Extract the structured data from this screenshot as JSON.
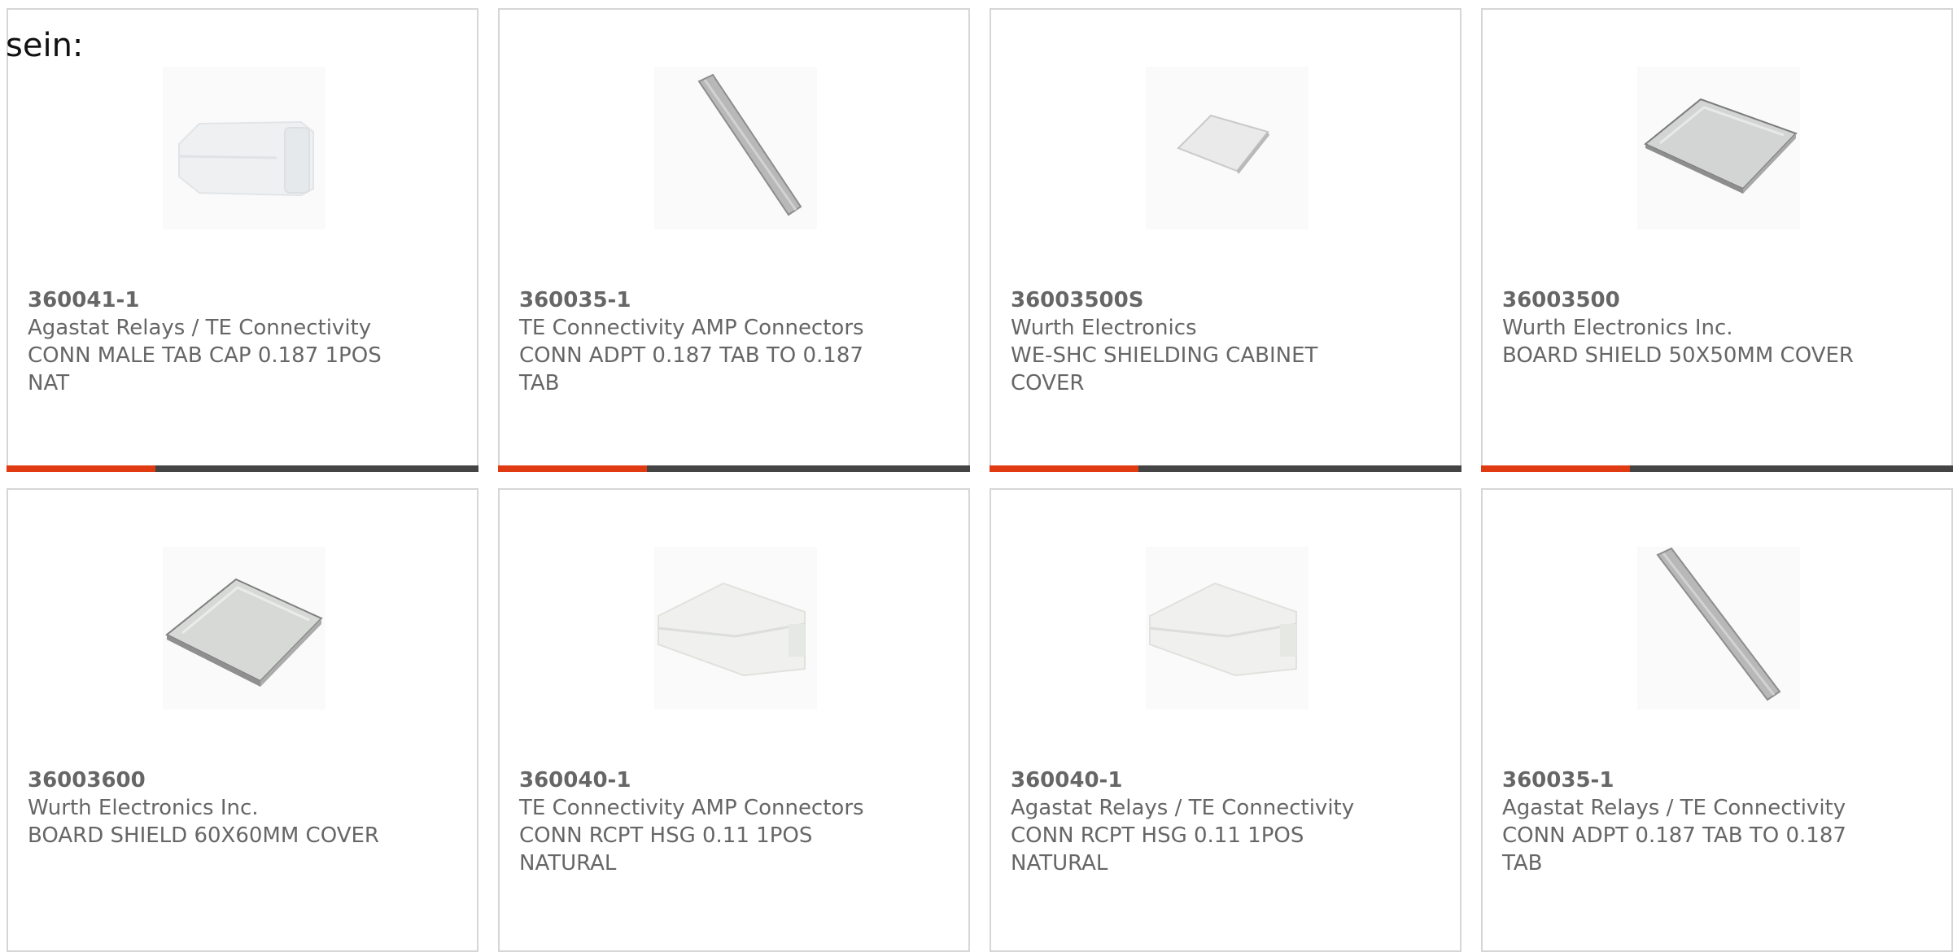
{
  "page_label": "sein:",
  "colors": {
    "accent": "#e03a12",
    "bar": "#444444",
    "text": "#666666",
    "border": "#d6d6d6"
  },
  "products": [
    {
      "part_number": "360041-1",
      "manufacturer": "Agastat Relays / TE Connectivity",
      "description": "CONN MALE TAB CAP 0.187 1POS NAT",
      "image": "white-tab-cap"
    },
    {
      "part_number": "360035-1",
      "manufacturer": "TE Connectivity AMP Connectors",
      "description": "CONN ADPT 0.187 TAB TO 0.187 TAB",
      "image": "metal-strip"
    },
    {
      "part_number": "36003500S",
      "manufacturer": "Wurth Electronics",
      "description": "WE-SHC SHIELDING CABINET COVER",
      "image": "small-plate"
    },
    {
      "part_number": "36003500",
      "manufacturer": "Wurth Electronics Inc.",
      "description": "BOARD SHIELD 50X50MM COVER",
      "image": "shield-cover"
    },
    {
      "part_number": "36003600",
      "manufacturer": "Wurth Electronics Inc.",
      "description": "BOARD SHIELD 60X60MM COVER",
      "image": "shield-cover"
    },
    {
      "part_number": "360040-1",
      "manufacturer": "TE Connectivity AMP Connectors",
      "description": "CONN RCPT HSG 0.11 1POS NATURAL",
      "image": "white-housing"
    },
    {
      "part_number": "360040-1",
      "manufacturer": "Agastat Relays / TE Connectivity",
      "description": "CONN RCPT HSG 0.11 1POS NATURAL",
      "image": "white-housing"
    },
    {
      "part_number": "360035-1",
      "manufacturer": "Agastat Relays / TE Connectivity",
      "description": "CONN ADPT 0.187 TAB TO 0.187 TAB",
      "image": "metal-strip"
    }
  ]
}
